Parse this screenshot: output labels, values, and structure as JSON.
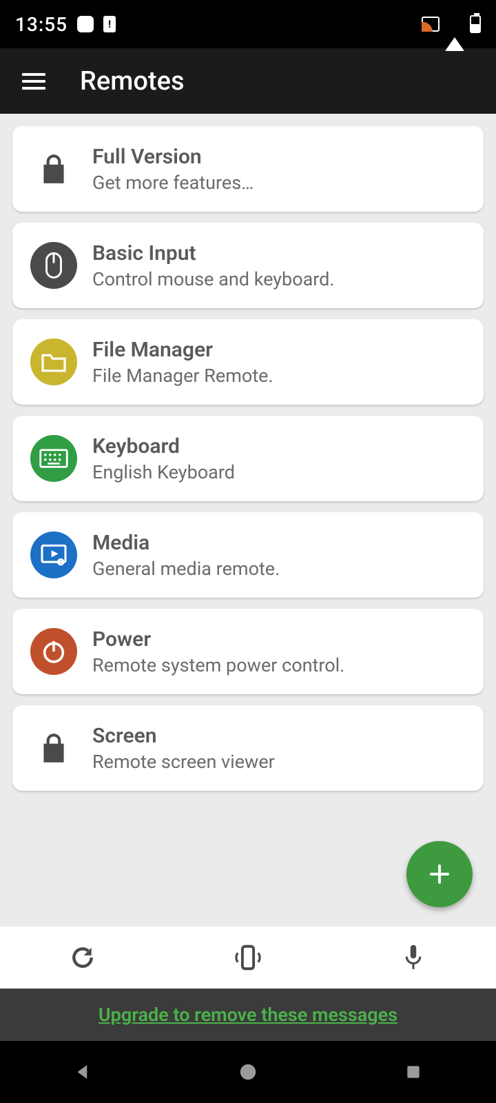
{
  "statusbar": {
    "time": "13:55"
  },
  "appbar": {
    "title": "Remotes"
  },
  "items": [
    {
      "title": "Full Version",
      "sub": "Get more features…"
    },
    {
      "title": "Basic Input",
      "sub": "Control mouse and keyboard."
    },
    {
      "title": "File Manager",
      "sub": "File Manager Remote."
    },
    {
      "title": "Keyboard",
      "sub": "English Keyboard"
    },
    {
      "title": "Media",
      "sub": "General media remote."
    },
    {
      "title": "Power",
      "sub": "Remote system power control."
    },
    {
      "title": "Screen",
      "sub": "Remote screen viewer"
    }
  ],
  "ad": {
    "text": "Upgrade to remove these messages"
  }
}
